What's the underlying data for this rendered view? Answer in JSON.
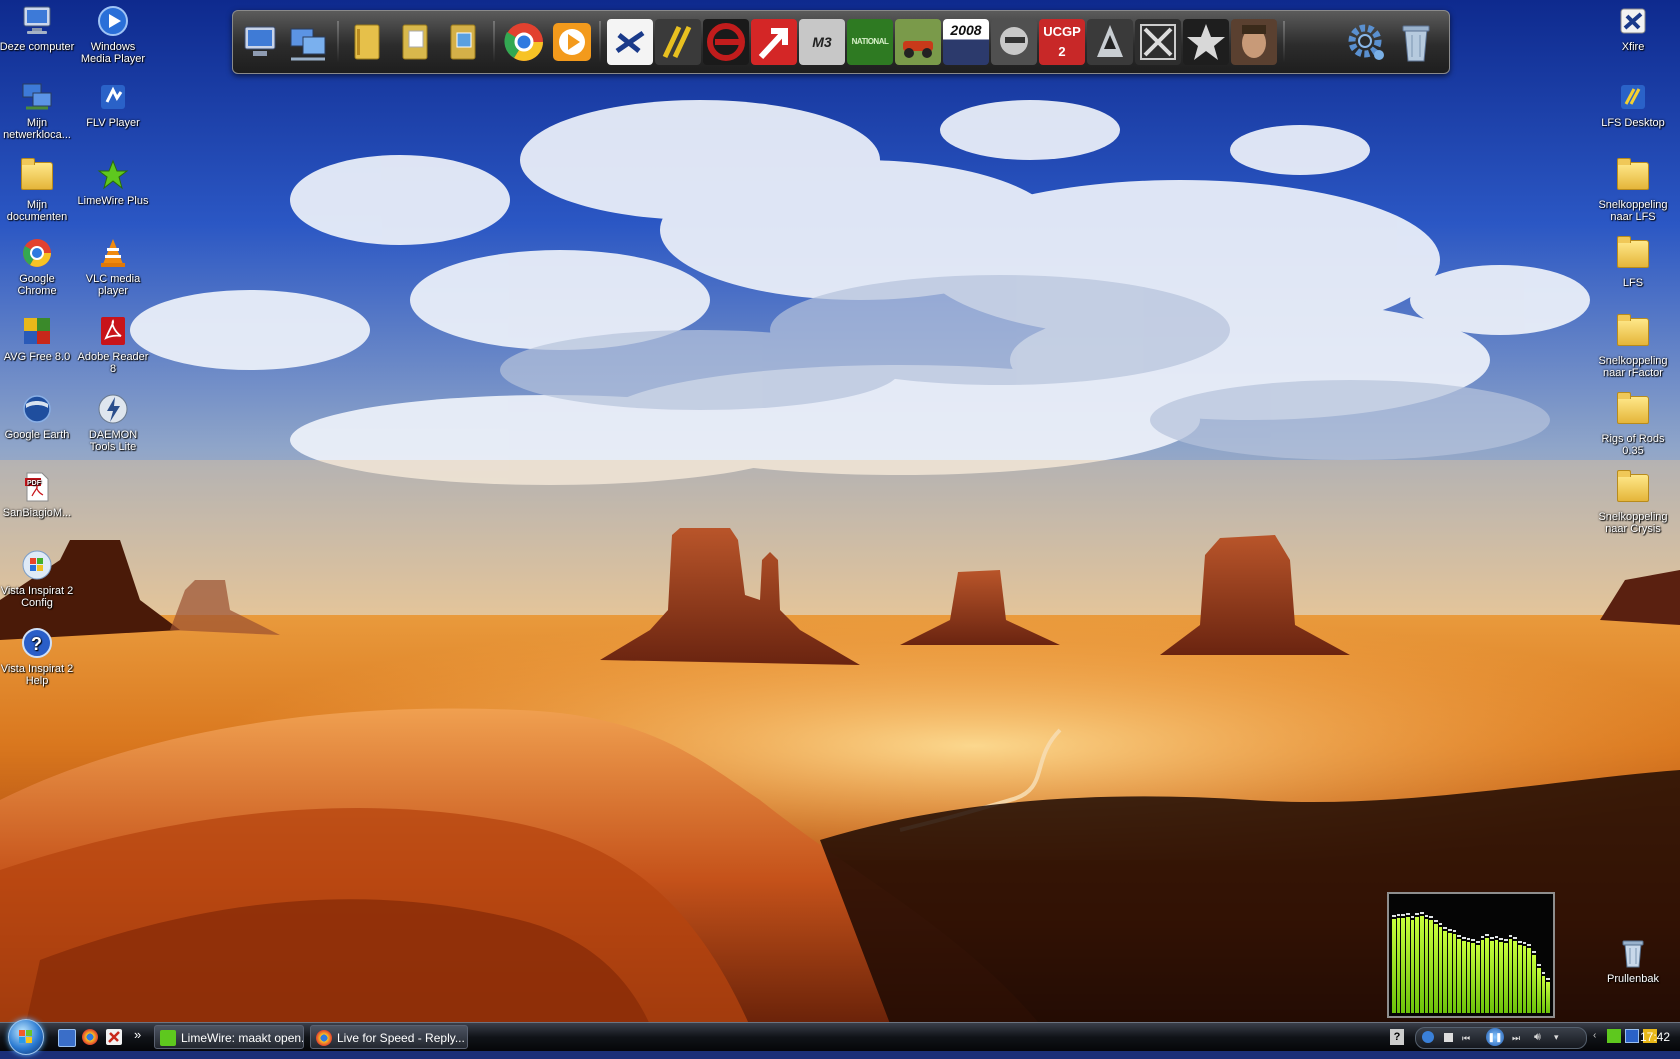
{
  "desktop": {
    "left_icons": [
      {
        "label": "Deze computer",
        "icon": "computer-icon"
      },
      {
        "label": "Windows Media Player",
        "icon": "media-player-icon"
      },
      {
        "label": "Mijn netwerkloca...",
        "icon": "network-icon"
      },
      {
        "label": "FLV Player",
        "icon": "flv-player-icon"
      },
      {
        "label": "Mijn documenten",
        "icon": "documents-icon"
      },
      {
        "label": "LimeWire Plus",
        "icon": "limewire-icon"
      },
      {
        "label": "Google Chrome",
        "icon": "chrome-icon"
      },
      {
        "label": "VLC media player",
        "icon": "vlc-icon"
      },
      {
        "label": "AVG Free 8.0",
        "icon": "avg-icon"
      },
      {
        "label": "Adobe Reader 8",
        "icon": "adobe-reader-icon"
      },
      {
        "label": "Google Earth",
        "icon": "google-earth-icon"
      },
      {
        "label": "DAEMON Tools Lite",
        "icon": "daemon-tools-icon"
      },
      {
        "label": "SanBiagioM...",
        "icon": "pdf-file-icon"
      },
      {
        "label": "Vista Inspirat 2 Config",
        "icon": "vista-config-icon"
      },
      {
        "label": "Vista Inspirat 2 Help",
        "icon": "help-icon"
      }
    ],
    "right_icons": [
      {
        "label": "Xfire",
        "icon": "xfire-icon"
      },
      {
        "label": "LFS Desktop",
        "icon": "lfs-desktop-icon"
      },
      {
        "label": "Snelkoppeling naar LFS",
        "icon": "folder-shortcut-icon"
      },
      {
        "label": "LFS",
        "icon": "folder-icon"
      },
      {
        "label": "Snelkoppeling naar rFactor",
        "icon": "folder-shortcut-icon"
      },
      {
        "label": "Rigs of Rods 0.35",
        "icon": "folder-icon"
      },
      {
        "label": "Snelkoppeling naar Crysis",
        "icon": "folder-shortcut-icon"
      },
      {
        "label": "Prullenbak",
        "icon": "recycle-bin-icon"
      }
    ]
  },
  "dock": {
    "items": [
      {
        "name": "my-computer-icon",
        "color": "#6f8fc7"
      },
      {
        "name": "network-icon",
        "color": "#7aa0d6"
      },
      {
        "name": "folder-icon",
        "color": "#e6c04a"
      },
      {
        "name": "documents-folder-icon",
        "color": "#d8b84c"
      },
      {
        "name": "pictures-folder-icon",
        "color": "#d4b048"
      },
      {
        "name": "chrome-icon",
        "color": "#e2412f"
      },
      {
        "name": "media-player-icon",
        "color": "#f39a1c"
      },
      {
        "name": "xfire-icon",
        "color": "#f2f2f2"
      },
      {
        "name": "lfs-icon",
        "color": "#c9a01a"
      },
      {
        "name": "rfactor-icon",
        "color": "#c21c1c"
      },
      {
        "name": "red-arrow-game-icon",
        "color": "#d42626"
      },
      {
        "name": "m3-game-icon",
        "color": "#c7c7c7"
      },
      {
        "name": "national-game-icon",
        "color": "#3a8e2a"
      },
      {
        "name": "offroad-game-icon",
        "color": "#6a8f3a"
      },
      {
        "name": "racing-2008-icon",
        "color": "#3c4a7a"
      },
      {
        "name": "helmet-game-icon",
        "color": "#8a8a8a"
      },
      {
        "name": "ucgp2-game-icon",
        "color": "#c82828"
      },
      {
        "name": "assassins-creed-icon",
        "color": "#9aa0a6"
      },
      {
        "name": "crysis-icon",
        "color": "#3a3a3a"
      },
      {
        "name": "star-game-icon",
        "color": "#2a2a2a"
      },
      {
        "name": "portrait-game-icon",
        "color": "#7a5a3a"
      },
      {
        "name": "settings-gear-icon",
        "color": "#5a90d0"
      },
      {
        "name": "recycle-bin-icon",
        "color": "#9cb4cf"
      }
    ],
    "special_labels": {
      "racing_2008": "2008",
      "ucgp2": "UCGP 2",
      "m3": "M3",
      "national": "NATIONAL"
    }
  },
  "taskbar": {
    "quick_launch": [
      "show-desktop-icon",
      "chrome-icon",
      "xfire-icon"
    ],
    "overflow": "»",
    "tasks": [
      {
        "label": "LimeWire: maakt open...",
        "icon": "limewire-icon"
      },
      {
        "label": "Live for Speed - Reply...",
        "icon": "chrome-icon"
      }
    ],
    "clock": "17:42"
  },
  "meter": {
    "levels": [
      0.81,
      0.82,
      0.82,
      0.83,
      0.8,
      0.83,
      0.84,
      0.81,
      0.8,
      0.77,
      0.74,
      0.71,
      0.69,
      0.68,
      0.64,
      0.62,
      0.61,
      0.6,
      0.59,
      0.63,
      0.65,
      0.62,
      0.63,
      0.61,
      0.6,
      0.64,
      0.62,
      0.59,
      0.58,
      0.56,
      0.5,
      0.39,
      0.32,
      0.27
    ]
  }
}
